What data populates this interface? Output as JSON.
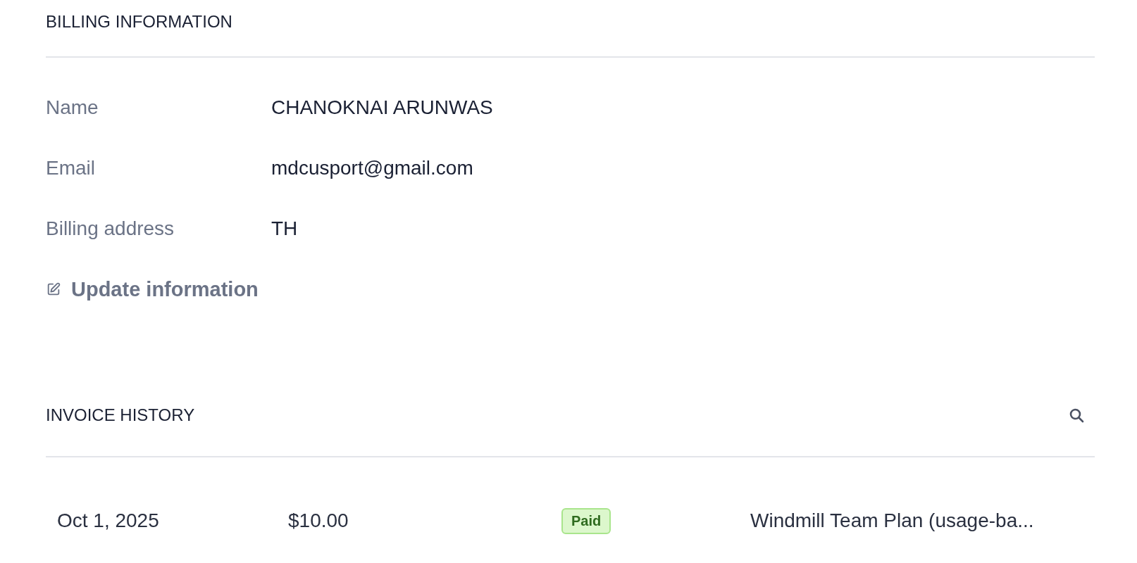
{
  "billing": {
    "title": "BILLING INFORMATION",
    "fields": [
      {
        "label": "Name",
        "value": "CHANOKNAI ARUNWAS"
      },
      {
        "label": "Email",
        "value": "mdcusport@gmail.com"
      },
      {
        "label": "Billing address",
        "value": "TH"
      }
    ],
    "update_link": "Update information"
  },
  "invoices": {
    "title": "INVOICE HISTORY",
    "rows": [
      {
        "date": "Oct 1, 2025",
        "amount": "$10.00",
        "status": "Paid",
        "description": "Windmill Team Plan (usage-ba..."
      }
    ]
  }
}
